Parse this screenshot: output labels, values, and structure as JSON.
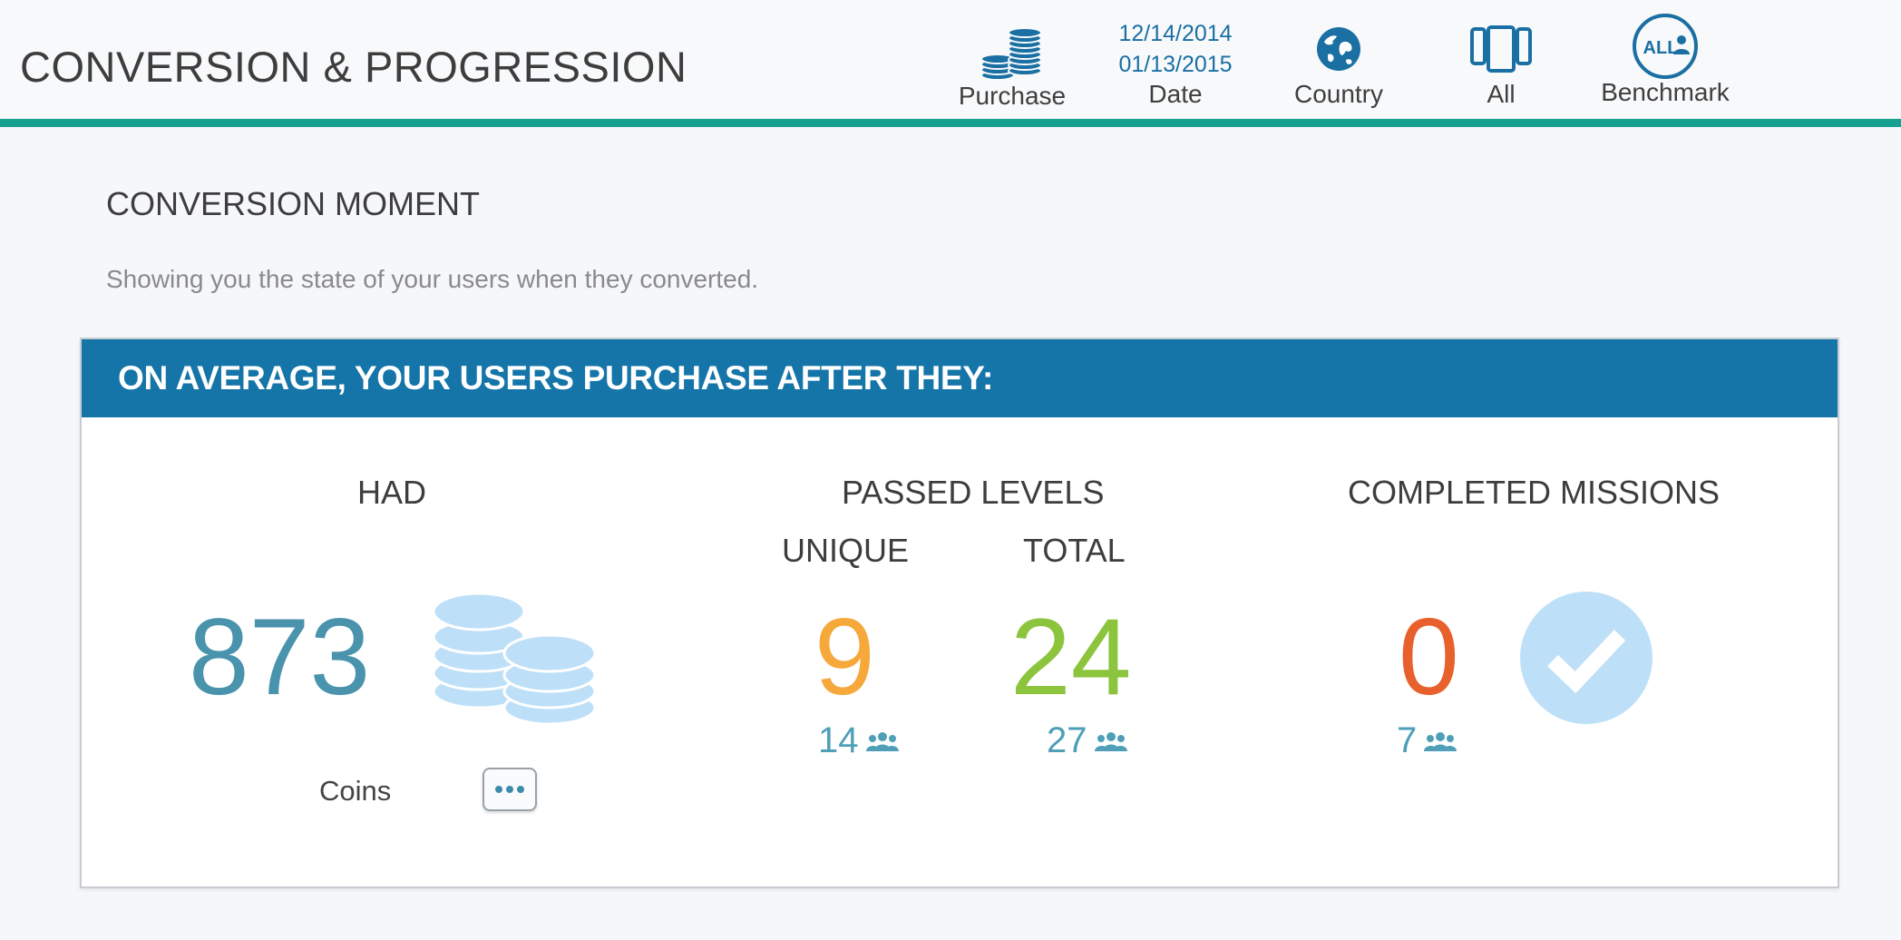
{
  "header": {
    "title": "CONVERSION & PROGRESSION",
    "purchase_label": "Purchase",
    "date_start": "12/14/2014",
    "date_end": "01/13/2015",
    "date_label": "Date",
    "country_label": "Country",
    "all_label": "All",
    "benchmark_label": "Benchmark",
    "benchmark_icon_text": "ALL"
  },
  "section": {
    "title": "CONVERSION MOMENT",
    "subtitle": "Showing you the state of your users when they converted."
  },
  "card": {
    "heading": "ON AVERAGE, YOUR USERS PURCHASE AFTER THEY:",
    "had": {
      "title": "HAD",
      "value": "873",
      "unit": "Coins",
      "more_icon": "ellipsis-icon"
    },
    "passed_levels": {
      "title": "PASSED LEVELS",
      "unique_label": "UNIQUE",
      "unique_value": "9",
      "unique_users": "14",
      "total_label": "TOTAL",
      "total_value": "24",
      "total_users": "27"
    },
    "completed_missions": {
      "title": "COMPLETED MISSIONS",
      "value": "0",
      "users": "7"
    }
  },
  "colors": {
    "accent_teal": "#16a08f",
    "header_blue": "#1575a8",
    "coins_value": "#4a93ad",
    "unique_value": "#f6a93a",
    "total_value": "#8cc43d",
    "missions_value": "#e8602c",
    "icon_light_blue": "#bde0f8"
  }
}
